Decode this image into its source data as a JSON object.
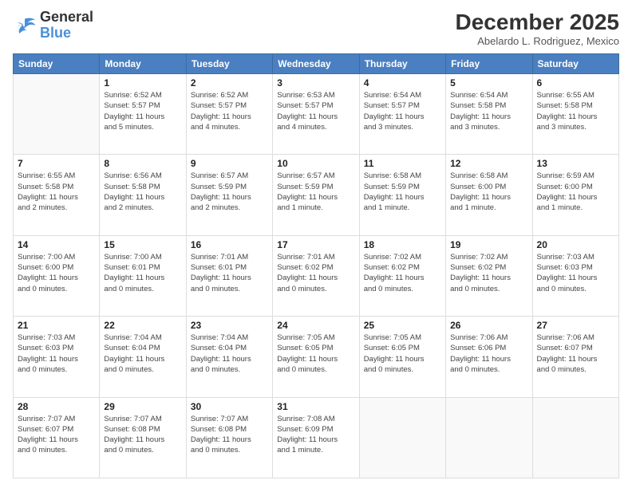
{
  "header": {
    "logo_general": "General",
    "logo_blue": "Blue",
    "month_title": "December 2025",
    "location": "Abelardo L. Rodriguez, Mexico"
  },
  "calendar": {
    "days_of_week": [
      "Sunday",
      "Monday",
      "Tuesday",
      "Wednesday",
      "Thursday",
      "Friday",
      "Saturday"
    ],
    "weeks": [
      [
        {
          "day": "",
          "info": ""
        },
        {
          "day": "1",
          "info": "Sunrise: 6:52 AM\nSunset: 5:57 PM\nDaylight: 11 hours\nand 5 minutes."
        },
        {
          "day": "2",
          "info": "Sunrise: 6:52 AM\nSunset: 5:57 PM\nDaylight: 11 hours\nand 4 minutes."
        },
        {
          "day": "3",
          "info": "Sunrise: 6:53 AM\nSunset: 5:57 PM\nDaylight: 11 hours\nand 4 minutes."
        },
        {
          "day": "4",
          "info": "Sunrise: 6:54 AM\nSunset: 5:57 PM\nDaylight: 11 hours\nand 3 minutes."
        },
        {
          "day": "5",
          "info": "Sunrise: 6:54 AM\nSunset: 5:58 PM\nDaylight: 11 hours\nand 3 minutes."
        },
        {
          "day": "6",
          "info": "Sunrise: 6:55 AM\nSunset: 5:58 PM\nDaylight: 11 hours\nand 3 minutes."
        }
      ],
      [
        {
          "day": "7",
          "info": "Sunrise: 6:55 AM\nSunset: 5:58 PM\nDaylight: 11 hours\nand 2 minutes."
        },
        {
          "day": "8",
          "info": "Sunrise: 6:56 AM\nSunset: 5:58 PM\nDaylight: 11 hours\nand 2 minutes."
        },
        {
          "day": "9",
          "info": "Sunrise: 6:57 AM\nSunset: 5:59 PM\nDaylight: 11 hours\nand 2 minutes."
        },
        {
          "day": "10",
          "info": "Sunrise: 6:57 AM\nSunset: 5:59 PM\nDaylight: 11 hours\nand 1 minute."
        },
        {
          "day": "11",
          "info": "Sunrise: 6:58 AM\nSunset: 5:59 PM\nDaylight: 11 hours\nand 1 minute."
        },
        {
          "day": "12",
          "info": "Sunrise: 6:58 AM\nSunset: 6:00 PM\nDaylight: 11 hours\nand 1 minute."
        },
        {
          "day": "13",
          "info": "Sunrise: 6:59 AM\nSunset: 6:00 PM\nDaylight: 11 hours\nand 1 minute."
        }
      ],
      [
        {
          "day": "14",
          "info": "Sunrise: 7:00 AM\nSunset: 6:00 PM\nDaylight: 11 hours\nand 0 minutes."
        },
        {
          "day": "15",
          "info": "Sunrise: 7:00 AM\nSunset: 6:01 PM\nDaylight: 11 hours\nand 0 minutes."
        },
        {
          "day": "16",
          "info": "Sunrise: 7:01 AM\nSunset: 6:01 PM\nDaylight: 11 hours\nand 0 minutes."
        },
        {
          "day": "17",
          "info": "Sunrise: 7:01 AM\nSunset: 6:02 PM\nDaylight: 11 hours\nand 0 minutes."
        },
        {
          "day": "18",
          "info": "Sunrise: 7:02 AM\nSunset: 6:02 PM\nDaylight: 11 hours\nand 0 minutes."
        },
        {
          "day": "19",
          "info": "Sunrise: 7:02 AM\nSunset: 6:02 PM\nDaylight: 11 hours\nand 0 minutes."
        },
        {
          "day": "20",
          "info": "Sunrise: 7:03 AM\nSunset: 6:03 PM\nDaylight: 11 hours\nand 0 minutes."
        }
      ],
      [
        {
          "day": "21",
          "info": "Sunrise: 7:03 AM\nSunset: 6:03 PM\nDaylight: 11 hours\nand 0 minutes."
        },
        {
          "day": "22",
          "info": "Sunrise: 7:04 AM\nSunset: 6:04 PM\nDaylight: 11 hours\nand 0 minutes."
        },
        {
          "day": "23",
          "info": "Sunrise: 7:04 AM\nSunset: 6:04 PM\nDaylight: 11 hours\nand 0 minutes."
        },
        {
          "day": "24",
          "info": "Sunrise: 7:05 AM\nSunset: 6:05 PM\nDaylight: 11 hours\nand 0 minutes."
        },
        {
          "day": "25",
          "info": "Sunrise: 7:05 AM\nSunset: 6:05 PM\nDaylight: 11 hours\nand 0 minutes."
        },
        {
          "day": "26",
          "info": "Sunrise: 7:06 AM\nSunset: 6:06 PM\nDaylight: 11 hours\nand 0 minutes."
        },
        {
          "day": "27",
          "info": "Sunrise: 7:06 AM\nSunset: 6:07 PM\nDaylight: 11 hours\nand 0 minutes."
        }
      ],
      [
        {
          "day": "28",
          "info": "Sunrise: 7:07 AM\nSunset: 6:07 PM\nDaylight: 11 hours\nand 0 minutes."
        },
        {
          "day": "29",
          "info": "Sunrise: 7:07 AM\nSunset: 6:08 PM\nDaylight: 11 hours\nand 0 minutes."
        },
        {
          "day": "30",
          "info": "Sunrise: 7:07 AM\nSunset: 6:08 PM\nDaylight: 11 hours\nand 0 minutes."
        },
        {
          "day": "31",
          "info": "Sunrise: 7:08 AM\nSunset: 6:09 PM\nDaylight: 11 hours\nand 1 minute."
        },
        {
          "day": "",
          "info": ""
        },
        {
          "day": "",
          "info": ""
        },
        {
          "day": "",
          "info": ""
        }
      ]
    ]
  }
}
